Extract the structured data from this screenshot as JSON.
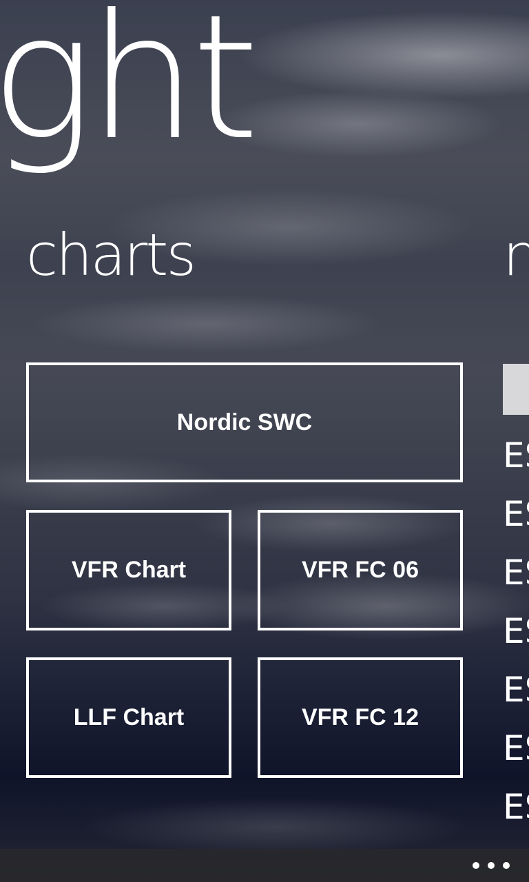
{
  "panorama": {
    "title": "ght"
  },
  "section": {
    "title": "charts"
  },
  "next_section": {
    "title_peek": "n"
  },
  "tiles": [
    {
      "label": "Nordic SWC"
    },
    {
      "label": "VFR Chart"
    },
    {
      "label": "VFR FC 06"
    },
    {
      "label": "LLF Chart"
    },
    {
      "label": "VFR FC 12"
    }
  ],
  "next_list": [
    "ES",
    "ES",
    "ES",
    "ES",
    "ES",
    "ES",
    "ES"
  ],
  "appbar": {
    "more_icon": "ellipsis-icon"
  },
  "colors": {
    "text": "#ffffff",
    "tile_border": "#ffffff",
    "appbar": "#28282c"
  }
}
